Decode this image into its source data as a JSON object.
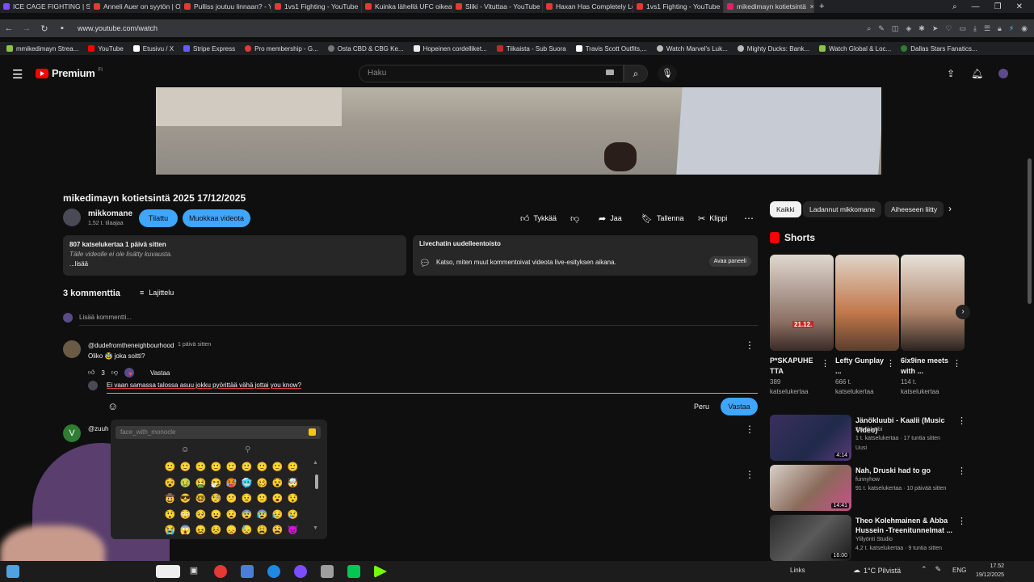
{
  "browser": {
    "tabs": [
      {
        "title": "ICE CAGE FIGHTING | Sun"
      },
      {
        "title": "Anneli Auer on syytön | Oi"
      },
      {
        "title": "Pulliss joutuu linnaan? - Yo"
      },
      {
        "title": "1vs1 Fighting - YouTube"
      },
      {
        "title": "Kuinka lähellä UFC oikeasti"
      },
      {
        "title": "Sliki - Vituttaa - YouTube"
      },
      {
        "title": "Haxan Has Completely Lo"
      },
      {
        "title": "1vs1 Fighting - YouTube"
      },
      {
        "title": "mikedimayn kotietsintä"
      }
    ],
    "url": "www.youtube.com/watch",
    "bookmarks": [
      "mmikedimayn Strea...",
      "YouTube",
      "Etusivu / X",
      "Stripe Express",
      "Pro membership - G...",
      "Osta CBD & CBG Ke...",
      "Hopeinen cordelliket...",
      "Tiikaista - Sub Suora",
      "Travis Scott Outfits,...",
      "Watch Marvel's Luk...",
      "Mighty Ducks: Bank...",
      "Watch Global & Loc...",
      "Dallas Stars Fanatics..."
    ]
  },
  "header": {
    "logo_text": "Premium",
    "logo_region": "FI",
    "search_placeholder": "Haku"
  },
  "video": {
    "title": "mikedimayn kotietsintä 2025 17/12/2025",
    "channel_name": "mikkomane",
    "subscribers": "1,52 t. tilaajaa",
    "subscribe_label": "Tilattu",
    "edit_label": "Muokkaa videota",
    "like_label": "Tykkää",
    "share_label": "Jaa",
    "save_label": "Tallenna",
    "clip_label": "Klippi"
  },
  "description": {
    "meta": "807 katselukertaa  1 päivä sitten",
    "line1": "Tälle videolle ei ole lisätty kuvausta.",
    "more": "...lisää"
  },
  "livechat": {
    "title": "Livechatin uudelleentoisto",
    "text": "Katso, miten muut kommentoivat videota live-esityksen aikana.",
    "open_label": "Avaa paneeli"
  },
  "comments": {
    "count": "3 kommenttia",
    "sort_label": "Lajittelu",
    "add_placeholder": "Lisää kommentti...",
    "items": [
      {
        "author": "@dudefromtheneighbourhood",
        "time": "1 päivä sitten",
        "text": "Oliko 🥸 joka soitti?",
        "likes": "3",
        "reply_label": "Vastaa"
      },
      {
        "author": "@zuuh",
        "avatar_letter": "V"
      }
    ],
    "reply_draft": "Ei vaan samassa talossa asuu jokku pyörittää vähä jottai you know?",
    "cancel_label": "Peru",
    "submit_label": "Vastaa"
  },
  "emoji_picker": {
    "search_value": "face_with_monocle",
    "emojis": [
      "🙂",
      "🙂",
      "🙂",
      "🙂",
      "🙂",
      "🙂",
      "🙂",
      "🙂",
      "🙂",
      "😵",
      "🤢",
      "🤮",
      "🤧",
      "🥵",
      "🥶",
      "🥴",
      "😵",
      "🤯",
      "🤠",
      "😎",
      "🤓",
      "🧐",
      "😕",
      "😟",
      "🙁",
      "😮",
      "😯",
      "😲",
      "😳",
      "🥺",
      "😦",
      "😧",
      "😨",
      "😰",
      "😥",
      "😢",
      "😭",
      "😱",
      "😖",
      "😣",
      "😞",
      "😓",
      "😩",
      "😫",
      "😈"
    ]
  },
  "sidebar": {
    "chips": [
      "Kaikki",
      "Ladannut mikkomane",
      "Aiheeseen liitty"
    ],
    "shorts_title": "Shorts",
    "shorts": [
      {
        "title": "P*SKAPUHE TTA",
        "views": "389 katselukertaa",
        "badge": "21.12."
      },
      {
        "title": "Lefty Gunplay ...",
        "views": "666 t. katselukertaa"
      },
      {
        "title": "6ix9ine meets with ...",
        "views": "114 t. katselukertaa"
      }
    ],
    "videos": [
      {
        "title": "Jänökluubi - Kaalii (Music Video)",
        "channel": "Jänökluubi",
        "meta": "1 t. katselukertaa · 17 tuntia sitten",
        "badge": "Uusi",
        "duration": "4:14"
      },
      {
        "title": "Nah, Druski had to go",
        "channel": "funnyhow",
        "meta": "91 t. katselukertaa · 10 päivää sitten",
        "duration": "14:41"
      },
      {
        "title": "Theo Kolehmainen & Abba Hussein -Treenitunnelmat ...",
        "channel": "Ylilyönti Studio",
        "meta": "4,2 t. katselukertaa · 9 tuntia sitten",
        "badge": "Uusi",
        "duration": "16:00"
      }
    ]
  },
  "taskbar": {
    "links_label": "Links",
    "weather": "1°C  Pilvistä",
    "language": "ENG",
    "time": "17.52",
    "date": "19/12/2025"
  }
}
